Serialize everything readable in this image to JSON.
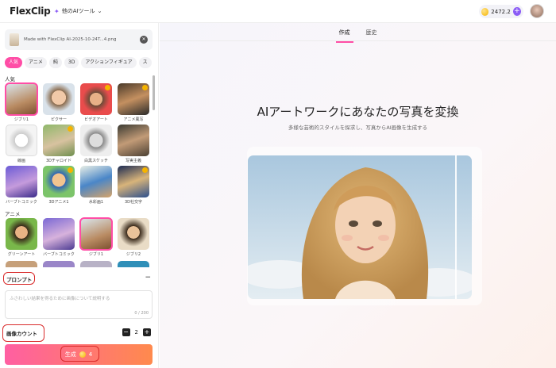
{
  "header": {
    "logo": "FlexClip",
    "ai_tools_label": "他のAIツール",
    "credits": "2472.2"
  },
  "left": {
    "file_name": "Made with FlexClip AI-2025-10-24T...4.png",
    "chips": [
      "人気",
      "アニメ",
      "純",
      "3D",
      "アクションフィギュア",
      "ス"
    ],
    "popular_title": "人気",
    "popular": [
      "ジブリ1",
      "ピクサー",
      "ビデオアート",
      "アニメ風写",
      "線画",
      "3Dチャロイド",
      "白黒スケッチ",
      "写実主義",
      "バーブトコミック",
      "3Dアニメ1",
      "水彩画1",
      "3D社交字"
    ],
    "anime_title": "アニメ",
    "anime": [
      "グリーンアート",
      "バーブトコミック",
      "ジブリ1",
      "ジブリ2"
    ],
    "prompt_label": "プロンプト",
    "prompt_placeholder": "ふさわしい結果を得るために画像について説明する",
    "prompt_count": "0 / 200",
    "count_label": "画像カウント",
    "count_value": "2",
    "generate_label": "生成",
    "generate_cost": "4"
  },
  "main": {
    "tabs": [
      "作成",
      "歴史"
    ],
    "title": "AIアートワークにあなたの写真を変換",
    "subtitle": "多様な芸術的スタイルを探求し、写真からAI画像を生成する"
  }
}
